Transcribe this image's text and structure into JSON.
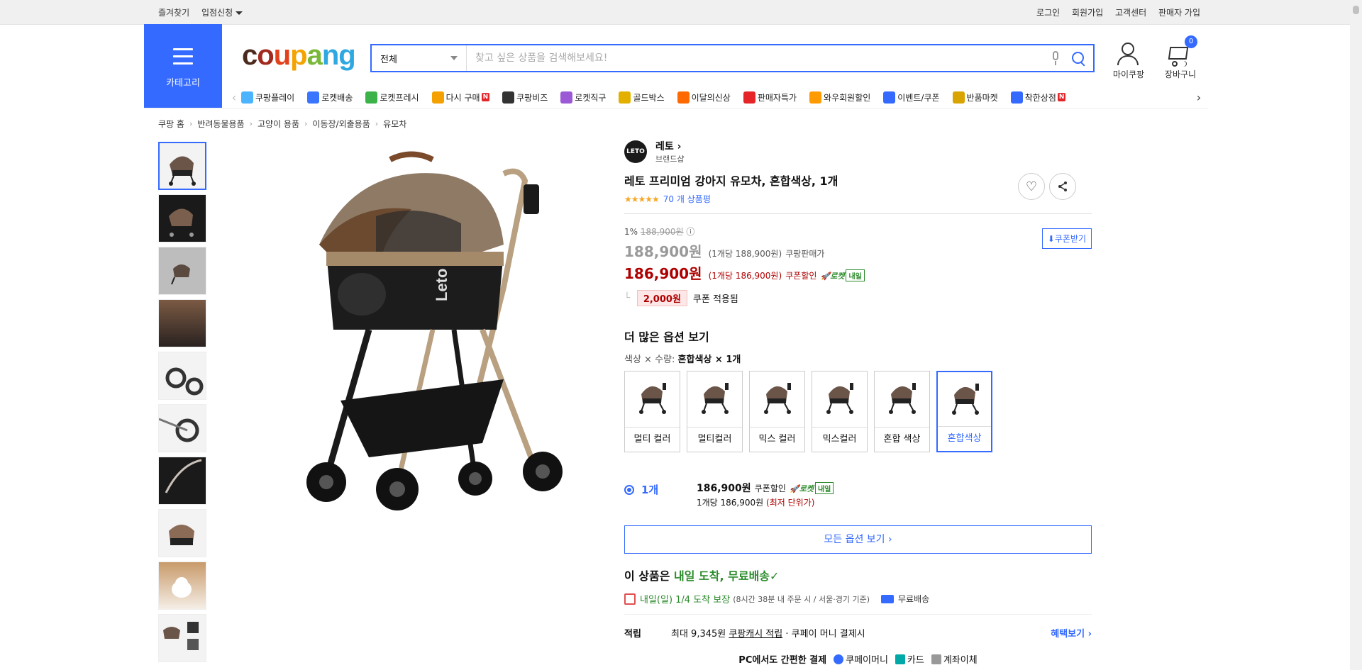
{
  "topbar": {
    "left": [
      "즐겨찾기",
      "입점신청"
    ],
    "right": [
      "로그인",
      "회원가입",
      "고객센터",
      "판매자 가입"
    ]
  },
  "header": {
    "category_label": "카테고리",
    "logo": "coupang",
    "search": {
      "category": "전체",
      "placeholder": "찾고 싶은 상품을 검색해보세요!"
    },
    "mycoupang": "마이쿠팡",
    "cart": "장바구니",
    "cart_count": "0"
  },
  "gnb": [
    {
      "label": "쿠팡플레이",
      "icon": "play-icon",
      "color": "#4cb3ff",
      "new": false
    },
    {
      "label": "로켓배송",
      "icon": "rocket-icon",
      "color": "#3a75ff",
      "new": false
    },
    {
      "label": "로켓프레시",
      "icon": "rocket-fresh-icon",
      "color": "#3bb34a",
      "new": false
    },
    {
      "label": "다시 구매",
      "icon": "rebuy-icon",
      "color": "#f3a000",
      "new": true
    },
    {
      "label": "쿠팡비즈",
      "icon": "biz-icon",
      "color": "#333333",
      "new": false
    },
    {
      "label": "로켓직구",
      "icon": "global-icon",
      "color": "#9b59d6",
      "new": false
    },
    {
      "label": "골드박스",
      "icon": "goldbox-icon",
      "color": "#e3b000",
      "new": false
    },
    {
      "label": "이달의신상",
      "icon": "new-icon",
      "color": "#ff6a00",
      "new": false
    },
    {
      "label": "판매자특가",
      "icon": "discount-icon",
      "color": "#e52528",
      "new": false
    },
    {
      "label": "와우회원할인",
      "icon": "wow-icon",
      "color": "#ff9a00",
      "new": false
    },
    {
      "label": "이벤트/쿠폰",
      "icon": "coupon-icon",
      "color": "#346aff",
      "new": false
    },
    {
      "label": "반품마켓",
      "icon": "market-icon",
      "color": "#d9a400",
      "new": false
    },
    {
      "label": "착한상점",
      "icon": "store-icon",
      "color": "#346aff",
      "new": true
    }
  ],
  "breadcrumb": [
    "쿠팡 홈",
    "반려동물용품",
    "고양이 용품",
    "이동장/외출용품",
    "유모차"
  ],
  "product": {
    "brand": "레토",
    "brand_logo_text": "LETO",
    "brand_sub": "브랜드샵",
    "title": "레토 프리미엄 강아지 유모차, 혼합색상, 1개",
    "stars": "★★★★★",
    "reviews": "70 개 상품평",
    "discount_rate": "1%",
    "original_price": "188,900원",
    "price": "188,900원",
    "price_unit": "(1개당 188,900원)",
    "price_label": "쿠팡판매가",
    "coupon_price": "186,900원",
    "coupon_unit": "(1개당 186,900원)",
    "coupon_label": "쿠폰할인",
    "coupon_button": "쿠폰받기",
    "coupon_amount": "2,000원",
    "coupon_applied": "쿠폰 적용됨",
    "rocket": "로켓",
    "rocket_tag": "내일"
  },
  "options": {
    "title": "더 많은 옵션 보기",
    "selected_prefix": "색상 × 수량:",
    "selected_value": "혼합색상 × 1개",
    "items": [
      "멀티 컬러",
      "멀티컬러",
      "믹스 컬러",
      "믹스컬러",
      "혼합 색상",
      "혼합색상"
    ],
    "selected_index": 5
  },
  "quantity": {
    "qty": "1개",
    "price": "186,900원",
    "coupon_label": "쿠폰할인",
    "unit_price": "1개당 186,900원",
    "lowest": "(최저 단위가)",
    "all_options": "모든 옵션 보기"
  },
  "shipping": {
    "prefix": "이 상품은",
    "highlight": "내일 도착, 무료배송✓",
    "eta": "내일(일) 1/4 도착 보장",
    "eta_detail": "(8시간 38분 내 주문 시 / 서울·경기 기준)",
    "free": "무료배송"
  },
  "reward": {
    "key": "적립",
    "text": "최대 9,345원",
    "cash": "쿠팡캐시 적립",
    "sep": "· 쿠페이 머니 결제시",
    "link": "혜택보기 ›"
  },
  "pay": {
    "text": "PC에서도 간편한 결제",
    "methods": [
      "쿠페이머니",
      "카드",
      "계좌이체"
    ]
  }
}
